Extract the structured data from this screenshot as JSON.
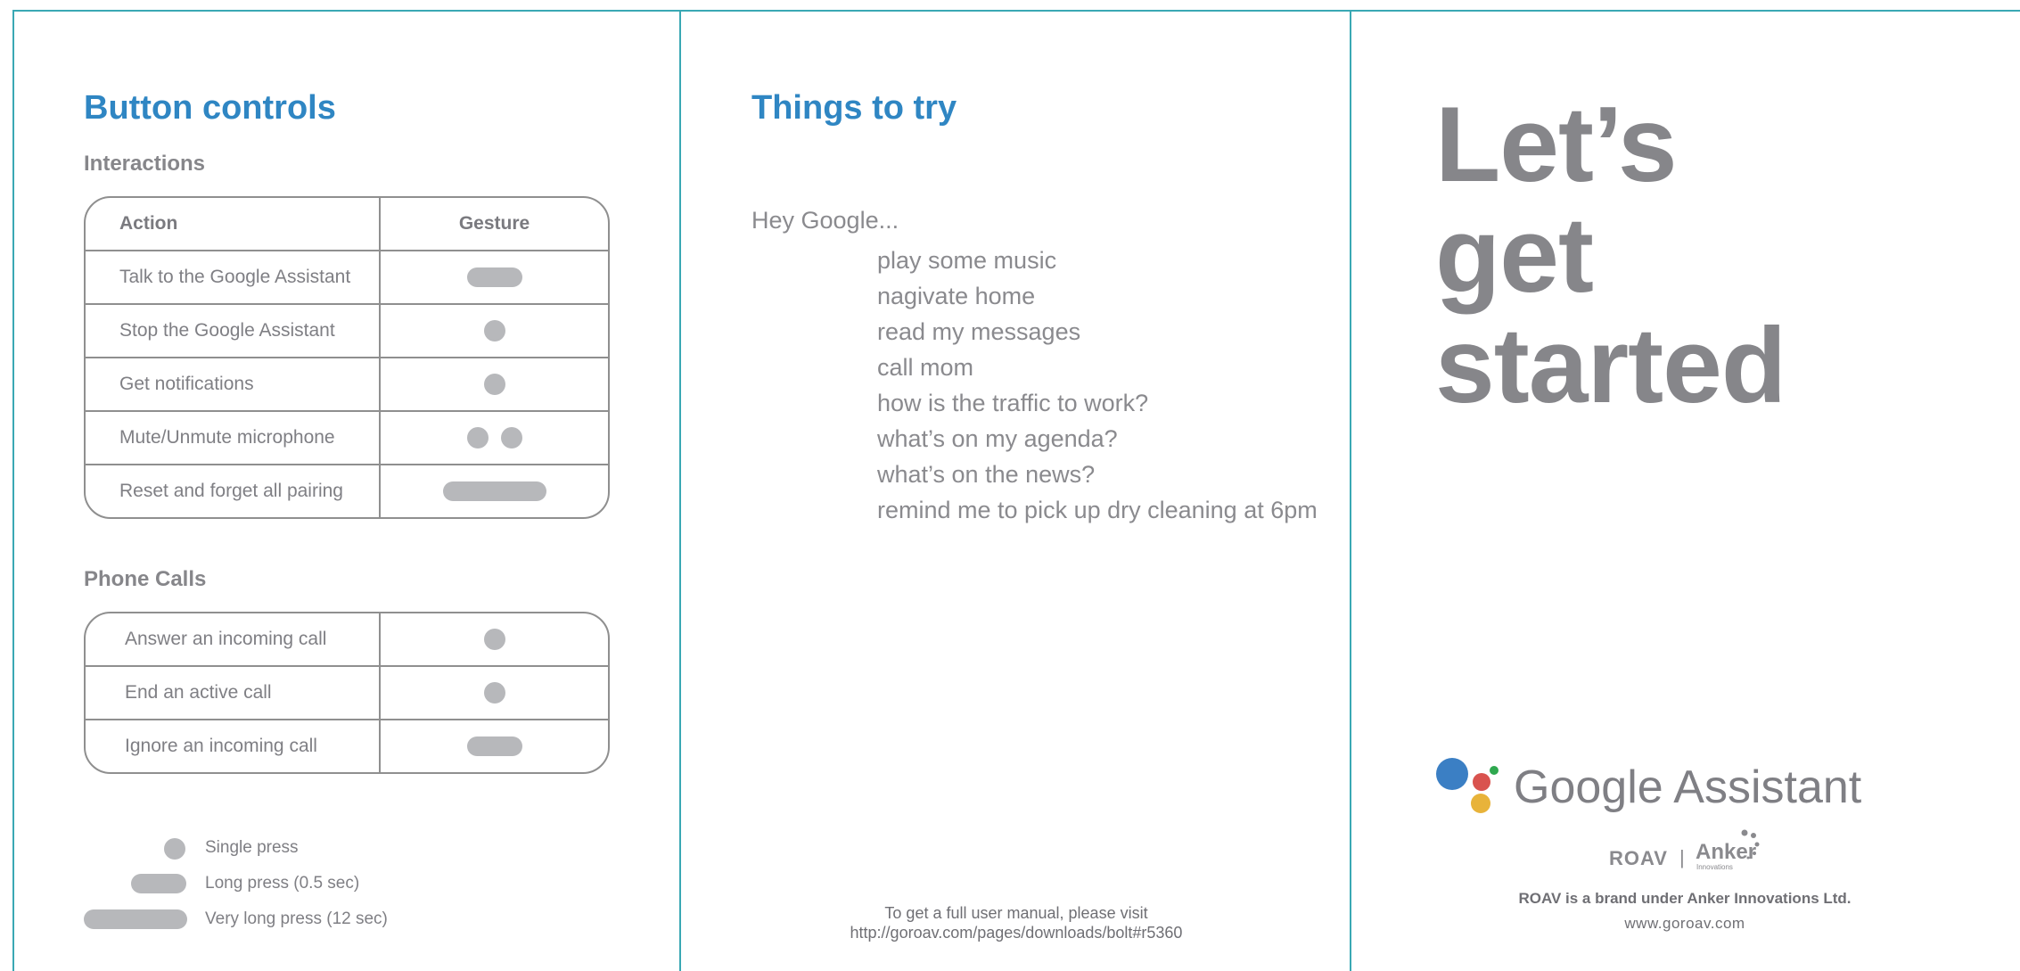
{
  "colors": {
    "accent": "#2f86c3",
    "rule": "#3aa8b4",
    "text": "#8a8a8e",
    "gesture": "#b7b8bb"
  },
  "button_controls": {
    "title": "Button controls",
    "interactions": {
      "title": "Interactions",
      "header": {
        "action": "Action",
        "gesture": "Gesture"
      },
      "rows": [
        {
          "action": "Talk to the Google Assistant",
          "gesture": "long-press"
        },
        {
          "action": "Stop the Google Assistant",
          "gesture": "single-press"
        },
        {
          "action": "Get notifications",
          "gesture": "single-press"
        },
        {
          "action": "Mute/Unmute microphone",
          "gesture": "double-press"
        },
        {
          "action": "Reset and forget all pairing",
          "gesture": "very-long-press"
        }
      ]
    },
    "phone_calls": {
      "title": "Phone Calls",
      "rows": [
        {
          "action": "Answer an incoming call",
          "gesture": "single-press"
        },
        {
          "action": "End an active call",
          "gesture": "single-press"
        },
        {
          "action": "Ignore an incoming call",
          "gesture": "long-press"
        }
      ]
    },
    "legend": [
      {
        "shape": "single-press",
        "label": "Single press"
      },
      {
        "shape": "long-press",
        "label": "Long press (0.5 sec)"
      },
      {
        "shape": "very-long-press",
        "label": "Very long press (12 sec)"
      }
    ]
  },
  "things_to_try": {
    "title": "Things to try",
    "prompt": "Hey Google...",
    "items": [
      "play some music",
      "nagivate home",
      "read my messages",
      "call mom",
      "how is the traffic to work?",
      "what’s on my agenda?",
      "what’s on the news?",
      "remind me to pick up dry cleaning at 6pm"
    ],
    "manual_line1": "To get a full user manual, please visit",
    "manual_line2": "http://goroav.com/pages/downloads/bolt#r5360"
  },
  "cover": {
    "headline": [
      "Let’s",
      "get",
      "started"
    ],
    "logo_text": "Google Assistant",
    "logo_colors": [
      "#3b7fc4",
      "#d9534f",
      "#e8b33a",
      "#2fa84f"
    ],
    "brand_roav": "ROAV",
    "brand_separator": "|",
    "brand_anker": "Anker",
    "brand_anker_sub": "Innovations",
    "tagline": "ROAV is a brand under Anker Innovations Ltd.",
    "website": "www.goroav.com"
  }
}
